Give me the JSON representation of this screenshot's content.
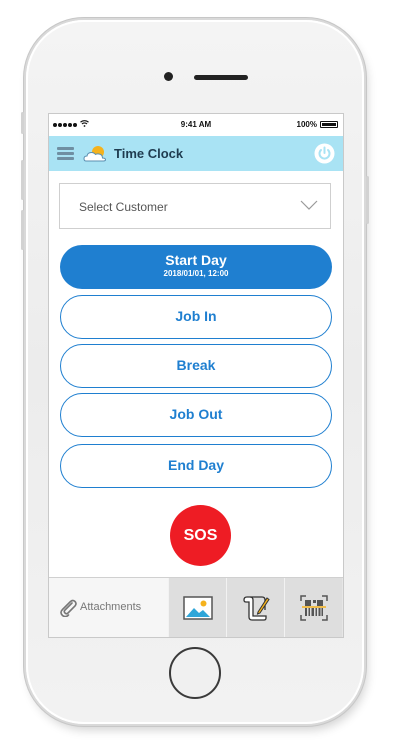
{
  "status_bar": {
    "signal": "•••••",
    "wifi_icon": "wifi-icon",
    "time": "9:41 AM",
    "battery_percent": "100%"
  },
  "header": {
    "menu_icon": "hamburger-menu-icon",
    "logo_icon": "cloud-clock-icon",
    "title": "Time Clock",
    "power_icon": "power-icon",
    "background_color": "#a9e3f4"
  },
  "customer_select": {
    "placeholder": "Select Customer",
    "icon": "chevron-down-icon"
  },
  "actions": {
    "start_day": {
      "label": "Start Day",
      "datetime": "2018/01/01, 12:00"
    },
    "job_in": "Job In",
    "break": "Break",
    "job_out": "Job Out",
    "end_day": "End Day",
    "accent_color": "#1f7fd0"
  },
  "sos": {
    "label": "SOS",
    "color": "#ee1c24"
  },
  "toolbar": {
    "attachments_label": "Attachments",
    "attachments_icon": "paperclip-icon",
    "items": [
      {
        "icon": "image-icon"
      },
      {
        "icon": "signature-document-icon"
      },
      {
        "icon": "barcode-scan-icon"
      }
    ]
  }
}
